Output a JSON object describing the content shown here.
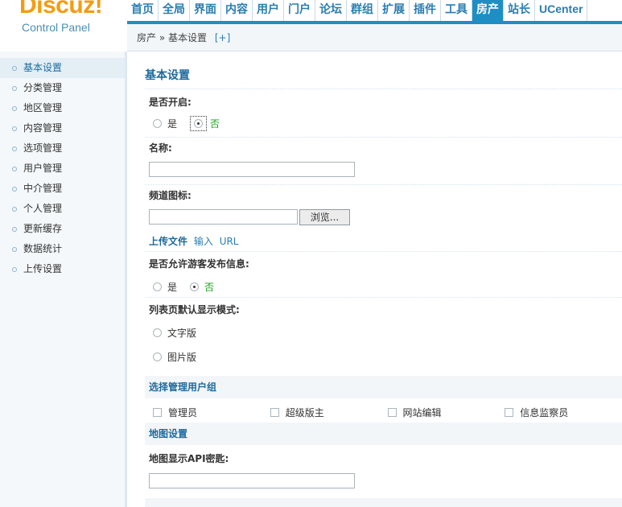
{
  "logo": {
    "brand": "Discuz!",
    "subtitle": "Control Panel"
  },
  "topnav": {
    "tabs": [
      {
        "label": "首页"
      },
      {
        "label": "全局"
      },
      {
        "label": "界面"
      },
      {
        "label": "内容"
      },
      {
        "label": "用户"
      },
      {
        "label": "门户"
      },
      {
        "label": "论坛"
      },
      {
        "label": "群组"
      },
      {
        "label": "扩展"
      },
      {
        "label": "插件"
      },
      {
        "label": "工具"
      },
      {
        "label": "房产",
        "active": true
      },
      {
        "label": "站长"
      },
      {
        "label": "UCenter"
      }
    ]
  },
  "breadcrumb": {
    "parent": "房产",
    "sep": "»",
    "current": "基本设置",
    "add": "[+]"
  },
  "sidebar": {
    "items": [
      {
        "label": "基本设置",
        "active": true
      },
      {
        "label": "分类管理"
      },
      {
        "label": "地区管理"
      },
      {
        "label": "内容管理"
      },
      {
        "label": "选项管理"
      },
      {
        "label": "用户管理"
      },
      {
        "label": "中介管理"
      },
      {
        "label": "个人管理"
      },
      {
        "label": "更新缓存"
      },
      {
        "label": "数据统计"
      },
      {
        "label": "上传设置"
      }
    ]
  },
  "main": {
    "title": "基本设置",
    "enable": {
      "label": "是否开启:",
      "yes": "是",
      "no": "否",
      "selected": "no"
    },
    "name": {
      "label": "名称:",
      "value": ""
    },
    "icon": {
      "label": "频道图标:",
      "value": "",
      "browse": "浏览...",
      "upload": "上传文件",
      "input": "输入",
      "url": "URL"
    },
    "guest_post": {
      "label": "是否允许游客发布信息:",
      "yes": "是",
      "no": "否",
      "selected": "no"
    },
    "list_mode": {
      "label": "列表页默认显示模式:",
      "options": [
        "文字版",
        "图片版"
      ]
    },
    "groups": {
      "title": "选择管理用户组",
      "options": [
        "管理员",
        "超级版主",
        "网站编辑",
        "信息监察员"
      ]
    },
    "map": {
      "title": "地图设置",
      "api_label": "地图显示API密匙:",
      "api_value": ""
    }
  }
}
